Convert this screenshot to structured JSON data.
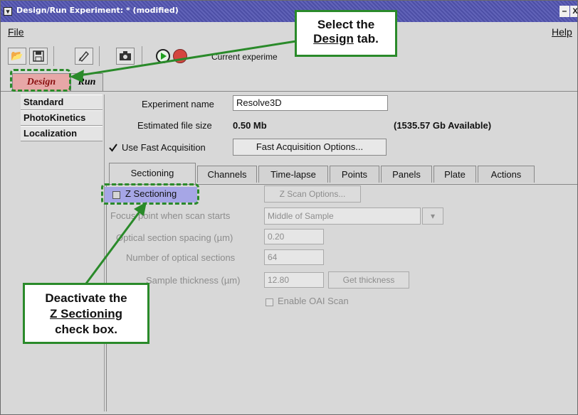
{
  "window": {
    "title": "Design/Run Experiment:  * (modified)",
    "minimize": "–",
    "close": "X"
  },
  "menubar": {
    "file": "File",
    "help": "Help"
  },
  "toolbar": {
    "current_experiment_label": "Current experime"
  },
  "top_tabs": [
    {
      "label": "Design",
      "active": true
    },
    {
      "label": "Run",
      "active": false
    }
  ],
  "sidebar": {
    "items": [
      {
        "label": "Standard"
      },
      {
        "label": "PhotoKinetics"
      },
      {
        "label": "Localization"
      }
    ]
  },
  "form": {
    "experiment_name_label": "Experiment name",
    "experiment_name_value": "Resolve3D",
    "file_size_label": "Estimated file size",
    "file_size_value": "0.50 Mb",
    "available": "(1535.57 Gb Available)",
    "fast_acq_label": "Use Fast Acquisition",
    "fast_acq_checked": true,
    "fast_acq_options": "Fast Acquisition Options..."
  },
  "design_tabs": [
    {
      "label": "Sectioning",
      "active": true
    },
    {
      "label": "Channels"
    },
    {
      "label": "Time-lapse"
    },
    {
      "label": "Points"
    },
    {
      "label": "Panels"
    },
    {
      "label": "Plate"
    },
    {
      "label": "Actions"
    }
  ],
  "sectioning": {
    "z_sectioning_label": "Z Sectioning",
    "z_sectioning_checked": false,
    "z_scan_options": "Z Scan Options...",
    "focus_label": "Focus point when scan starts",
    "focus_value": "Middle of Sample",
    "spacing_label": "Optical section spacing (µm)",
    "spacing_value": "0.20",
    "num_sections_label": "Number of optical sections",
    "num_sections_value": "64",
    "thickness_label": "Sample thickness (µm)",
    "thickness_value": "12.80",
    "get_thickness": "Get thickness",
    "oai_label": "Enable OAI Scan"
  },
  "annotations": {
    "top_callout_line1": "Select the",
    "top_callout_word": "Design",
    "top_callout_rest": " tab.",
    "bottom_callout_line1": "Deactivate the",
    "bottom_callout_word": "Z Sectioning",
    "bottom_callout_line3": "check box.",
    "accent": "#2a8a2a"
  }
}
